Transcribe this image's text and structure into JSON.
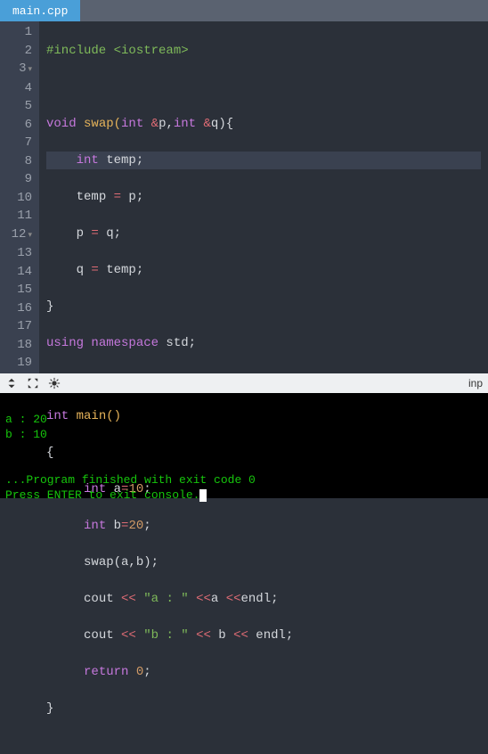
{
  "tab": {
    "name": "main.cpp"
  },
  "gutter": {
    "lines": [
      "1",
      "2",
      "3",
      "4",
      "5",
      "6",
      "7",
      "8",
      "9",
      "10",
      "11",
      "12",
      "13",
      "14",
      "15",
      "16",
      "17",
      "18",
      "19"
    ]
  },
  "code": {
    "l1_pre": "#include ",
    "l1_inc": "<iostream>",
    "l3_kw1": "void",
    "l3_fn": " swap(",
    "l3_kw2": "int",
    "l3_amp1": " &",
    "l3_p": "p,",
    "l3_kw3": "int",
    "l3_amp2": " &",
    "l3_q": "q",
    "l3_end": "){",
    "l4_kw": "int",
    "l4_rest": " temp;",
    "l5_a": "temp ",
    "l5_op": "=",
    "l5_b": " p;",
    "l6_a": "p ",
    "l6_op": "=",
    "l6_b": " q;",
    "l7_a": "q ",
    "l7_op": "=",
    "l7_b": " temp;",
    "l8": "}",
    "l9_kw": "using",
    "l9_ns": " namespace",
    "l9_std": " std",
    "l9_end": ";",
    "l11_kw": "int",
    "l11_fn": " main()",
    "l12": "{",
    "l13_kw": "int",
    "l13_a": " a",
    "l13_op": "=",
    "l13_n": "10",
    "l13_end": ";",
    "l14_kw": "int",
    "l14_a": " b",
    "l14_op": "=",
    "l14_n": "20",
    "l14_end": ";",
    "l15": "swap(a,b);",
    "l16_a": "cout ",
    "l16_op1": "<<",
    "l16_s": " \"a : \" ",
    "l16_op2": "<<",
    "l16_b": "a ",
    "l16_op3": "<<",
    "l16_c": "endl;",
    "l17_a": "cout ",
    "l17_op1": "<<",
    "l17_s": " \"b : \" ",
    "l17_op2": "<<",
    "l17_b": " b ",
    "l17_op3": "<<",
    "l17_c": " endl;",
    "l18_kw": "return",
    "l18_sp": " ",
    "l18_n": "0",
    "l18_end": ";",
    "l19": "}"
  },
  "console_bar": {
    "inp": "inp"
  },
  "console": {
    "l1": "a : 20",
    "l2": "b : 10",
    "l3": "",
    "l4": "",
    "l5": "...Program finished with exit code 0",
    "l6": "Press ENTER to exit console."
  }
}
